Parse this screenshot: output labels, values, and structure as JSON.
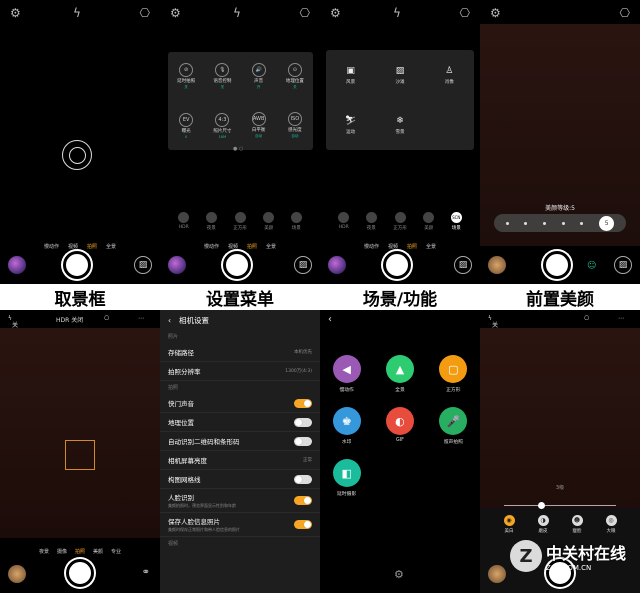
{
  "captions": [
    "取景框",
    "设置菜单",
    "场景/功能",
    "前置美颜"
  ],
  "icons": {
    "settings": "gear-icon",
    "flash": "flash-off-icon",
    "camera_switch": "camera-switch-icon"
  },
  "modes": {
    "items": [
      "慢动作",
      "视频",
      "拍照",
      "全景"
    ],
    "active": "拍照"
  },
  "settings_grid": {
    "items": [
      {
        "icon": "⊘",
        "label": "延时拍照",
        "sub": "关"
      },
      {
        "icon": "🎙",
        "label": "语音控制",
        "sub": "关"
      },
      {
        "icon": "🔊",
        "label": "声音",
        "sub": "开"
      },
      {
        "icon": "⊙",
        "label": "地理位置",
        "sub": "关"
      },
      {
        "icon": "EV",
        "label": "曝光",
        "sub": "0"
      },
      {
        "icon": "4:3",
        "label": "照片尺寸",
        "sub": "16M"
      },
      {
        "icon": "AWB",
        "label": "白平衡",
        "sub": "自动"
      },
      {
        "icon": "ISO",
        "label": "感光度",
        "sub": "自动"
      }
    ]
  },
  "quick_row": {
    "items": [
      "HDR",
      "夜景",
      "正方形",
      "美颜",
      "场景"
    ]
  },
  "scene_grid": {
    "items": [
      {
        "icon": "▣",
        "label": "风景"
      },
      {
        "icon": "▨",
        "label": "沙滩"
      },
      {
        "icon": "♙",
        "label": "肖像"
      },
      {
        "icon": "⛷",
        "label": "运动"
      },
      {
        "icon": "❄",
        "label": "雪景"
      }
    ]
  },
  "scene_quick_active": "SCN",
  "beauty": {
    "label": "美颜等级:5",
    "selected": "5",
    "dots": 5
  },
  "back_camera": {
    "flash": "关闭",
    "hdr": "HDR 关闭",
    "modes": [
      "夜景",
      "摄像",
      "拍照",
      "美颜",
      "专业"
    ],
    "active": "拍照"
  },
  "camera_settings": {
    "title": "相机设置",
    "sections": [
      {
        "header": "照片",
        "rows": [
          {
            "label": "存储路径",
            "value": "本机优先",
            "type": "value"
          },
          {
            "label": "拍照分辨率",
            "value": "1300万(4:3)",
            "type": "value"
          }
        ]
      },
      {
        "header": "拍照",
        "rows": [
          {
            "label": "快门声音",
            "type": "toggle",
            "on": true
          },
          {
            "label": "地理位置",
            "type": "toggle",
            "on": false
          },
          {
            "label": "自动识别二维码和条形码",
            "type": "toggle",
            "on": false
          },
          {
            "label": "相机屏幕亮度",
            "value": "正常",
            "type": "value"
          },
          {
            "label": "构图网格线",
            "type": "toggle",
            "on": false
          },
          {
            "label": "人脸识别",
            "sub": "美颜拍照时，预览界面显示性别和年龄",
            "type": "toggle",
            "on": true
          },
          {
            "label": "保存人脸信息照片",
            "sub": "美颜时保存正常照片和带人脸信息的照片",
            "type": "toggle",
            "on": true
          }
        ]
      },
      {
        "header": "视频",
        "rows": []
      }
    ]
  },
  "mode_grid": {
    "items": [
      {
        "icon": "◀",
        "label": "慢动作",
        "color": "#9b59b6"
      },
      {
        "icon": "▲",
        "label": "全景",
        "color": "#2ecc71"
      },
      {
        "icon": "▢",
        "label": "正方形",
        "color": "#f39c12"
      },
      {
        "icon": "♚",
        "label": "水印",
        "color": "#3498db"
      },
      {
        "icon": "◐",
        "label": "GIF",
        "color": "#e74c3c"
      },
      {
        "icon": "🎤",
        "label": "留声拍照",
        "color": "#27ae60"
      },
      {
        "icon": "◧",
        "label": "延时摄影",
        "color": "#1abc9c"
      }
    ]
  },
  "front_beauty": {
    "flash": "关闭",
    "level": "3级",
    "items": [
      {
        "label": "美白",
        "active": true
      },
      {
        "label": "磨皮",
        "active": false
      },
      {
        "label": "瘦脸",
        "active": false
      },
      {
        "label": "大眼",
        "active": false
      }
    ]
  },
  "watermark": {
    "brand": "中关村在线",
    "url": "ZOL.COM.CN",
    "logo": "Z"
  },
  "colors": {
    "accent": "#f6a623",
    "teal": "#1abc9c"
  }
}
